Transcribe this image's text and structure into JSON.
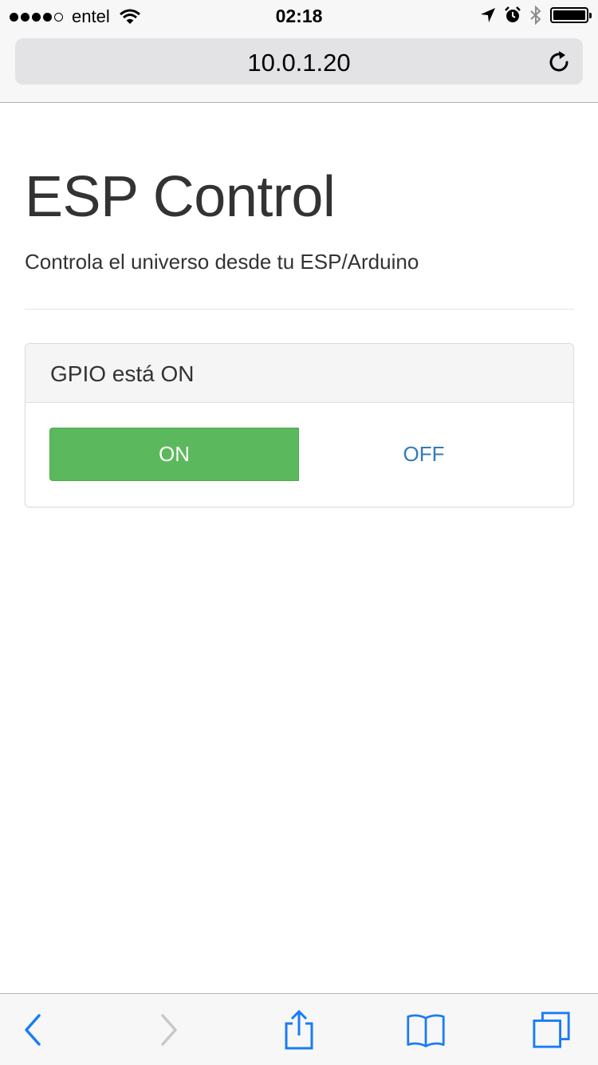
{
  "status_bar": {
    "carrier": "entel",
    "time": "02:18",
    "signal_bars_filled": 4,
    "signal_bars_total": 5,
    "icons": [
      "wifi-icon",
      "location-arrow-icon",
      "alarm-icon",
      "bluetooth-icon",
      "battery-icon"
    ]
  },
  "browser": {
    "url": "10.0.1.20",
    "reload_icon": "reload-icon"
  },
  "page": {
    "title": "ESP Control",
    "subtitle": "Controla el universo desde tu ESP/Arduino",
    "panel": {
      "heading": "GPIO está ON",
      "on_label": "ON",
      "off_label": "OFF"
    }
  },
  "toolbar": {
    "icons": [
      "back-icon",
      "forward-icon",
      "share-icon",
      "bookmarks-icon",
      "tabs-icon"
    ]
  },
  "colors": {
    "accent": "#1a7cf5",
    "success": "#5cb85c",
    "link": "#337ab7"
  }
}
